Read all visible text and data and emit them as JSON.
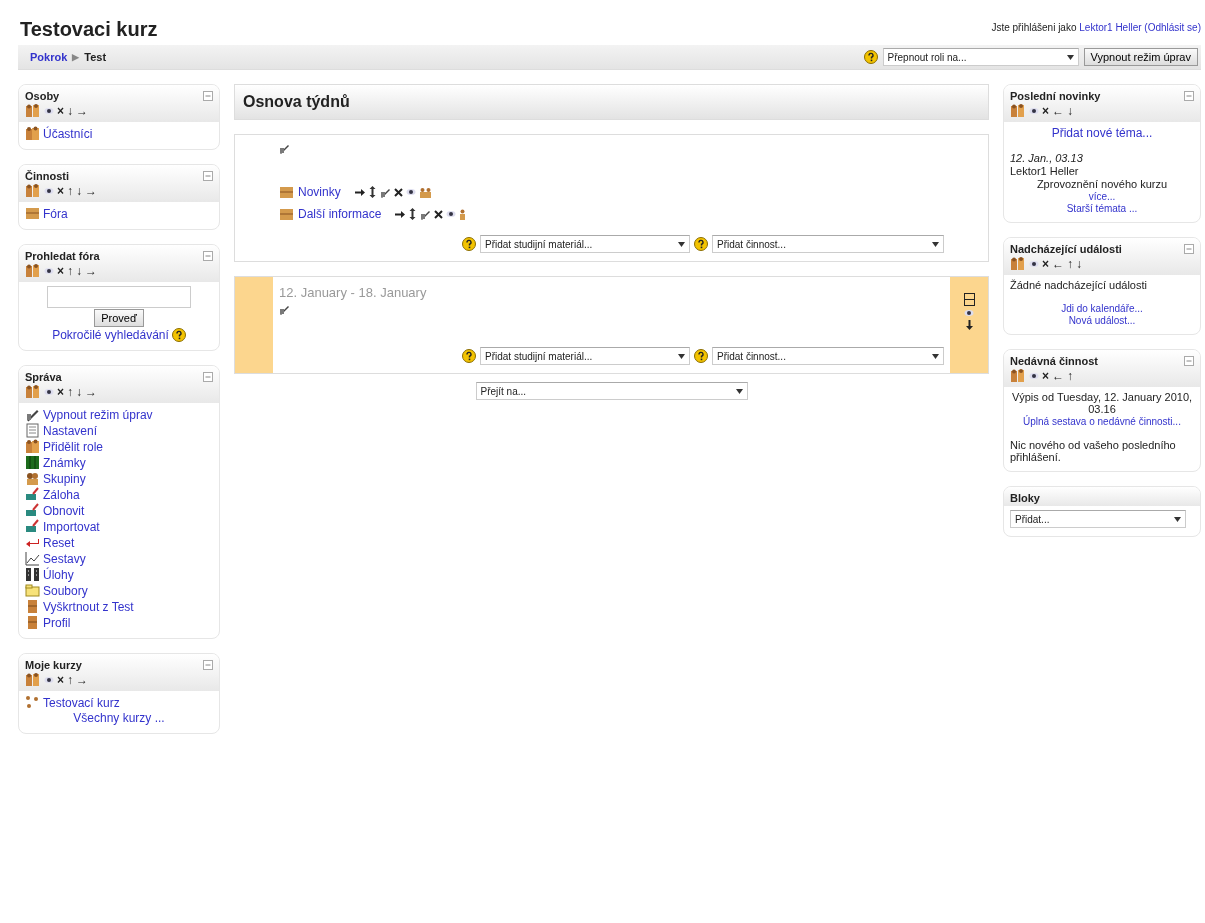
{
  "header": {
    "title": "Testovaci kurz",
    "login_prefix": "Jste přihlášeni jako",
    "user": "Lektor1 Heller",
    "logout": "(Odhlásit se)"
  },
  "navbar": {
    "breadcrumb": [
      {
        "text": "Pokrok",
        "link": true
      },
      {
        "text": "Test",
        "link": false
      }
    ],
    "separator": "▶",
    "role_select": "Přepnout roli na...",
    "edit_button": "Vypnout režim úprav"
  },
  "left_blocks": [
    {
      "title": "Osoby",
      "controls": [
        "×",
        "↓",
        "→"
      ],
      "content": [
        {
          "kind": "icon_link",
          "text": "Účastníci"
        }
      ]
    },
    {
      "title": "Činnosti",
      "controls": [
        "×",
        "↑",
        "↓",
        "→"
      ],
      "content": [
        {
          "kind": "icon_link",
          "text": "Fóra"
        }
      ]
    },
    {
      "title": "Prohledat fóra",
      "controls": [
        "×",
        "↑",
        "↓",
        "→"
      ],
      "content": [
        {
          "kind": "search",
          "text": "Proveď"
        },
        {
          "kind": "help_link",
          "text": "Pokročilé vyhledávání"
        }
      ]
    },
    {
      "title": "Správa",
      "controls": [
        "×",
        "↑",
        "↓",
        "→"
      ],
      "content": [
        {
          "kind": "icon_link",
          "text": "Vypnout režim úprav"
        },
        {
          "kind": "icon_link",
          "text": "Nastavení"
        },
        {
          "kind": "icon_link",
          "text": "Přidělit role"
        },
        {
          "kind": "icon_link",
          "text": "Známky"
        },
        {
          "kind": "icon_link",
          "text": "Skupiny"
        },
        {
          "kind": "icon_link",
          "text": "Záloha"
        },
        {
          "kind": "icon_link",
          "text": "Obnovit"
        },
        {
          "kind": "icon_link",
          "text": "Importovat"
        },
        {
          "kind": "icon_link",
          "text": "Reset"
        },
        {
          "kind": "icon_link",
          "text": "Sestavy"
        },
        {
          "kind": "icon_link",
          "text": "Úlohy"
        },
        {
          "kind": "icon_link",
          "text": "Soubory"
        },
        {
          "kind": "icon_link",
          "text": "Vyškrtnout z Test"
        },
        {
          "kind": "icon_link",
          "text": "Profil"
        }
      ]
    },
    {
      "title": "Moje kurzy",
      "controls": [
        "×",
        "↑",
        "→"
      ],
      "content": [
        {
          "kind": "icon_link",
          "text": "Testovací kurz"
        },
        {
          "kind": "link",
          "text": "Všechny kurzy ..."
        }
      ]
    }
  ],
  "main": {
    "title": "Osnova týdnů",
    "sections": [
      {
        "current": false,
        "activities": [
          {
            "name": "Novinky",
            "separate_groups": true
          },
          {
            "name": "Další informace",
            "separate_groups": false
          }
        ],
        "add_resource": "Přidat studijní materiál...",
        "add_activity": "Přidat činnost..."
      },
      {
        "current": true,
        "dates": "12. January - 18. January",
        "add_resource": "Přidat studijní materiál...",
        "add_activity": "Přidat činnost..."
      }
    ],
    "jump": "Přejít na..."
  },
  "right_blocks": [
    {
      "title": "Poslední novinky",
      "controls": [
        "×",
        "←",
        "↓"
      ],
      "content": [
        {
          "kind": "big_link",
          "text": "Přidat nové téma..."
        },
        {
          "kind": "spacer"
        },
        {
          "kind": "date",
          "text": "12. Jan., 03.13"
        },
        {
          "kind": "text",
          "text": "Lektor1 Heller"
        },
        {
          "kind": "centered_text",
          "text": "Zprovoznění nového kurzu"
        },
        {
          "kind": "link",
          "text": "více..."
        },
        {
          "kind": "link",
          "text": "Starší témata ..."
        }
      ]
    },
    {
      "title": "Nadcházející události",
      "controls": [
        "×",
        "←",
        "↑",
        "↓"
      ],
      "content": [
        {
          "kind": "text",
          "text": "Žádné nadcházející události"
        },
        {
          "kind": "spacer"
        },
        {
          "kind": "link",
          "text": "Jdi do kalendáře..."
        },
        {
          "kind": "link",
          "text": "Nová událost..."
        }
      ]
    },
    {
      "title": "Nedávná činnost",
      "controls": [
        "×",
        "←",
        "↑"
      ],
      "content": [
        {
          "kind": "centered_text",
          "text": "Výpis od Tuesday, 12. January 2010, 03.16"
        },
        {
          "kind": "link",
          "text": "Úplná sestava o nedávné činnosti..."
        },
        {
          "kind": "spacer"
        },
        {
          "kind": "text",
          "text": "Nic nového od vašeho posledního přihlášení."
        }
      ]
    },
    {
      "title": "Bloky",
      "content": [
        {
          "kind": "select",
          "text": "Přidat..."
        }
      ]
    }
  ]
}
